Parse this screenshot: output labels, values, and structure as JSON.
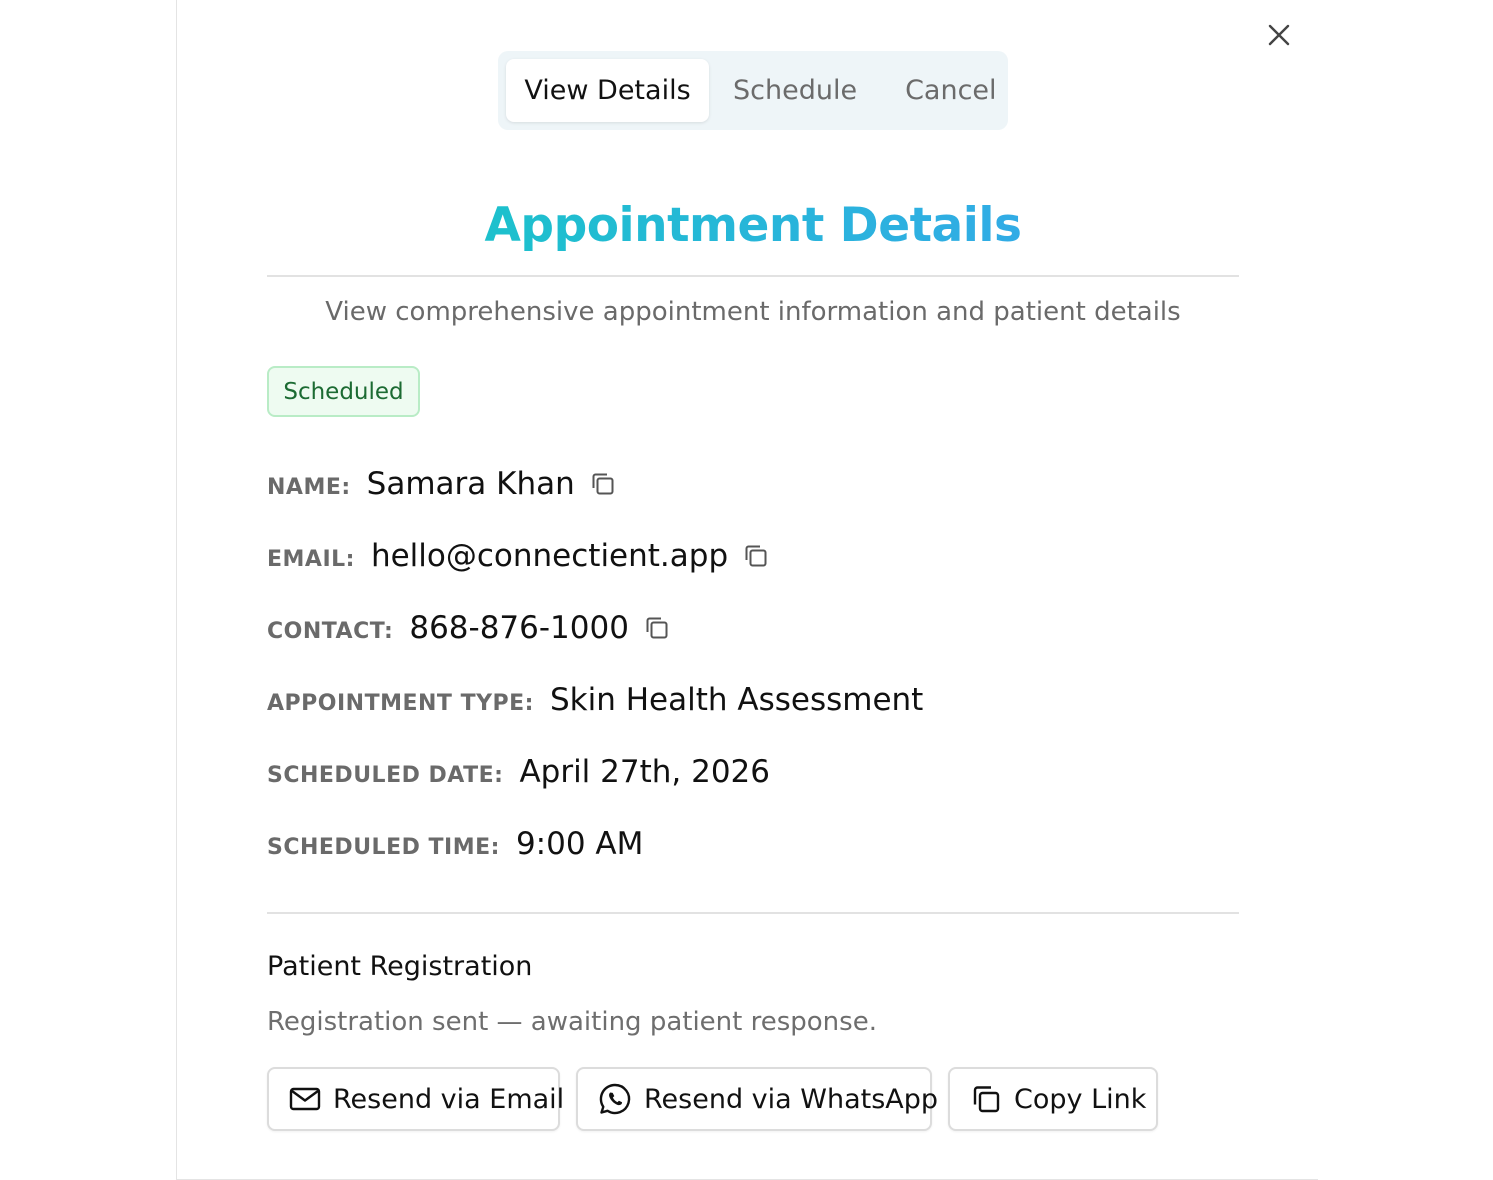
{
  "tabs": [
    {
      "label": "View Details",
      "active": true
    },
    {
      "label": "Schedule",
      "active": false
    },
    {
      "label": "Cancel",
      "active": false
    }
  ],
  "header": {
    "title": "Appointment Details",
    "subtitle": "View comprehensive appointment information and patient details",
    "title_gradient": [
      "#14c9c2",
      "#3aa3f0"
    ]
  },
  "status": {
    "label": "Scheduled",
    "color": "#1c6b33"
  },
  "fields": {
    "name": {
      "label": "NAME:",
      "value": "Samara Khan"
    },
    "email": {
      "label": "EMAIL:",
      "value": "hello@connectient.app"
    },
    "contact": {
      "label": "CONTACT:",
      "value": "868-876-1000"
    },
    "type": {
      "label": "APPOINTMENT TYPE:",
      "value": "Skin Health Assessment"
    },
    "date": {
      "label": "SCHEDULED DATE:",
      "value": "April 27th, 2026"
    },
    "time": {
      "label": "SCHEDULED TIME:",
      "value": "9:00 AM"
    }
  },
  "registration": {
    "title": "Patient Registration",
    "status": "Registration sent — awaiting patient response.",
    "actions": {
      "email": "Resend via Email",
      "whatsapp": "Resend via WhatsApp",
      "copy": "Copy Link"
    }
  },
  "icons": {
    "close": "close-icon",
    "copy": "copy-icon",
    "mail": "mail-icon",
    "whatsapp": "whatsapp-icon"
  }
}
